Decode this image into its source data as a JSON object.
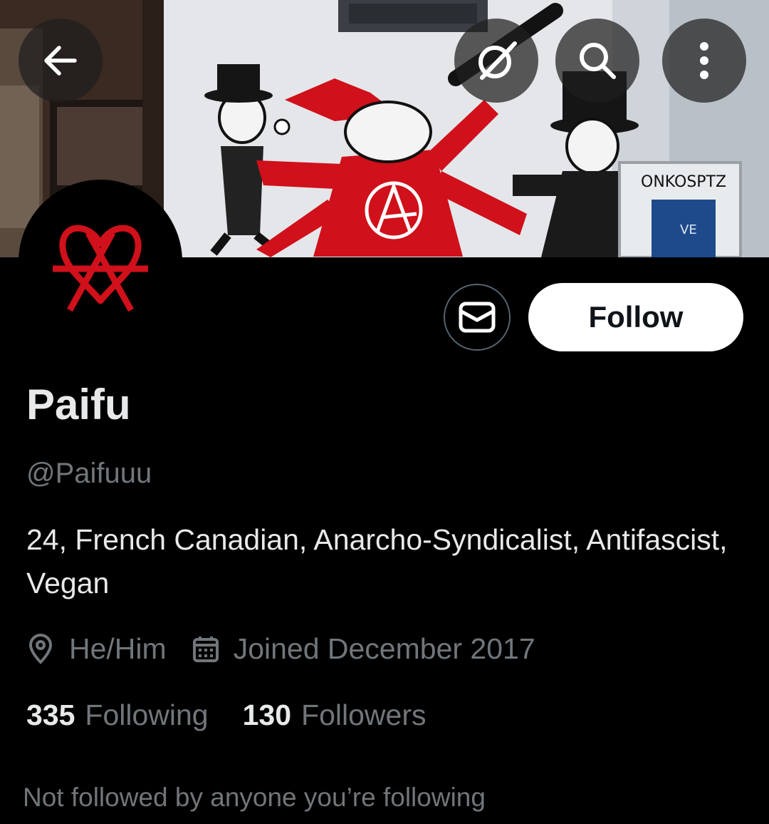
{
  "header": {
    "back_icon": "arrow-left-icon",
    "grok_icon": "grok-slash-icon",
    "search_icon": "search-icon",
    "more_icon": "more-vertical-icon"
  },
  "banner": {
    "graffiti_text": "ONKOSPTZ",
    "payphone_text": "VE"
  },
  "actions": {
    "message_icon": "envelope-icon",
    "follow_label": "Follow"
  },
  "profile": {
    "name": "Paifu",
    "handle": "@Paifuuu",
    "bio": "24, French Canadian, Anarcho-Syndicalist, Antifascist, Vegan",
    "pronouns": "He/Him",
    "joined": "Joined December 2017",
    "following_count": "335",
    "following_label": "Following",
    "followers_count": "130",
    "followers_label": "Followers",
    "mutuals_note": "Not followed by anyone you’re following"
  },
  "colors": {
    "background": "#000000",
    "accent_red": "#d0101a",
    "muted_text": "#71767b",
    "primary_text": "#e7e9ea",
    "follow_button": "#ffffff"
  }
}
